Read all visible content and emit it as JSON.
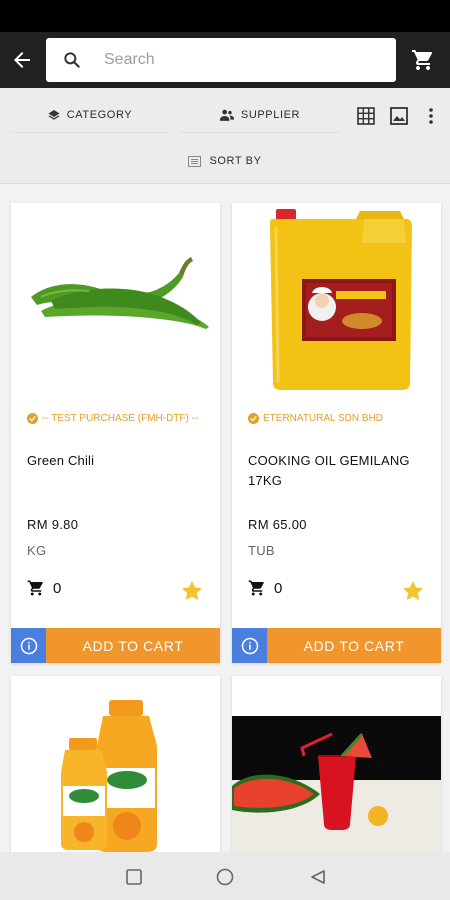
{
  "search": {
    "placeholder": "Search"
  },
  "filters": {
    "category_label": "CATEGORY",
    "supplier_label": "SUPPLIER",
    "sort_label": "SORT BY"
  },
  "products": [
    {
      "supplier": "-- TEST PURCHASE (FMH-DTF) --",
      "name": "Green Chili",
      "price": "RM 9.80",
      "unit": "KG",
      "qty": "0",
      "add_label": "ADD TO CART"
    },
    {
      "supplier": "ETERNATURAL SDN BHD",
      "name": "COOKING OIL GEMILANG 17KG",
      "price": "RM 65.00",
      "unit": "TUB",
      "qty": "0",
      "add_label": "ADD TO CART"
    }
  ],
  "colors": {
    "accent": "#f0962c",
    "info": "#4a7fe0",
    "supplier_text": "#e0a028",
    "star": "#f4c430",
    "appbar": "#212121"
  }
}
